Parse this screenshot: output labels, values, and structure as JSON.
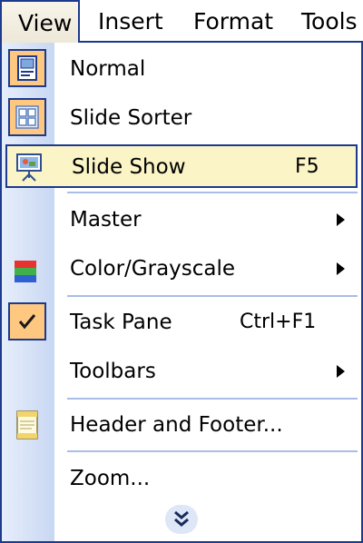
{
  "menubar": {
    "items": [
      {
        "label": "View",
        "active": true
      },
      {
        "label": "Insert",
        "active": false
      },
      {
        "label": "Format",
        "active": false
      },
      {
        "label": "Tools",
        "active": false
      }
    ]
  },
  "menu": {
    "items": [
      {
        "label": "Normal",
        "icon": "normal-view-icon",
        "checked": true
      },
      {
        "label": "Slide Sorter",
        "icon": "slide-sorter-icon",
        "checked": false
      },
      {
        "label": "Slide Show",
        "shortcut": "F5",
        "icon": "slide-show-icon",
        "highlighted": true
      },
      {
        "label": "Master",
        "submenu": true
      },
      {
        "label": "Color/Grayscale",
        "icon": "color-grayscale-icon",
        "submenu": true
      },
      {
        "label": "Task Pane",
        "shortcut": "Ctrl+F1",
        "icon": "checkmark-icon",
        "checked": true
      },
      {
        "label": "Toolbars",
        "submenu": true
      },
      {
        "label": "Header and Footer...",
        "icon": "header-footer-icon"
      },
      {
        "label": "Zoom..."
      }
    ],
    "expand_icon": "double-chevron-down-icon"
  },
  "colors": {
    "border": "#1c3a8e",
    "icon_strip": "#c8d7f2",
    "highlight": "#fbf4c6",
    "checked_bg": "#ffc880",
    "separator": "#a9bde6"
  }
}
